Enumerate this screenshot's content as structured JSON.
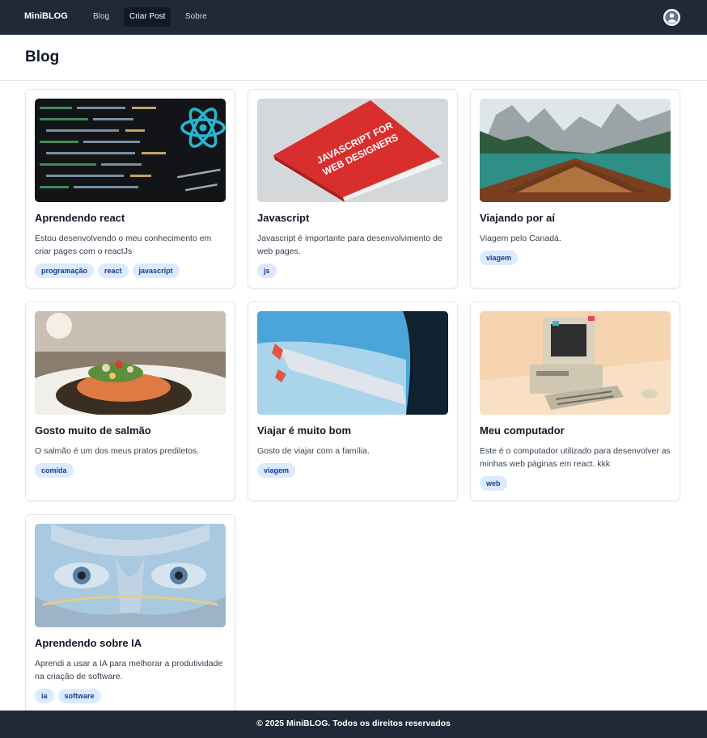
{
  "nav": {
    "brand": "MiniBLOG",
    "links": [
      {
        "label": "Blog"
      },
      {
        "label": "Criar Post"
      },
      {
        "label": "Sobre"
      }
    ],
    "active_link": "Criar Post",
    "avatar_icon": "user-avatar-icon"
  },
  "page": {
    "title": "Blog"
  },
  "posts": [
    {
      "title": "Aprendendo react",
      "description": "Estou desenvolvendo o meu conhecimento em criar pages com o reactJs",
      "tags": [
        "programação",
        "react",
        "javascript"
      ],
      "image": "react-code-screen"
    },
    {
      "title": "Javascript",
      "description": "Javascript é importante para desenvolvimento de web pages.",
      "tags": [
        "js"
      ],
      "image": "javascript-book"
    },
    {
      "title": "Viajando por aí",
      "description": "Viagem pelo Canadá.",
      "tags": [
        "viagem"
      ],
      "image": "lake-boat-mountains"
    },
    {
      "title": "Gosto muito de salmão",
      "description": "O salmão é um dos meus pratos prediletos.",
      "tags": [
        "comida"
      ],
      "image": "salmon-dish"
    },
    {
      "title": "Viajar é muito bom",
      "description": "Gosto de viajar com a família.",
      "tags": [
        "viagem"
      ],
      "image": "airplane-wing-window"
    },
    {
      "title": "Meu computador",
      "description": "Este é o computador utilizado para desenvolver as minhas web páginas em react. kkk",
      "tags": [
        "web"
      ],
      "image": "retro-computer"
    },
    {
      "title": "Aprendendo sobre IA",
      "description": "Aprendi a usar a IA para melhorar a produtividade na criação de software.",
      "tags": [
        "ia",
        "software"
      ],
      "image": "ai-robot-face"
    }
  ],
  "book_cover_text": {
    "line1": "JAVASCRIPT FOR",
    "line2": "WEB DESIGNERS"
  },
  "footer": {
    "text": "© 2025 MiniBLOG. Todos os direitos reservados"
  },
  "colors": {
    "nav_bg": "#1f2937",
    "tag_bg": "#dbeafe",
    "tag_text": "#1e3a8a"
  }
}
